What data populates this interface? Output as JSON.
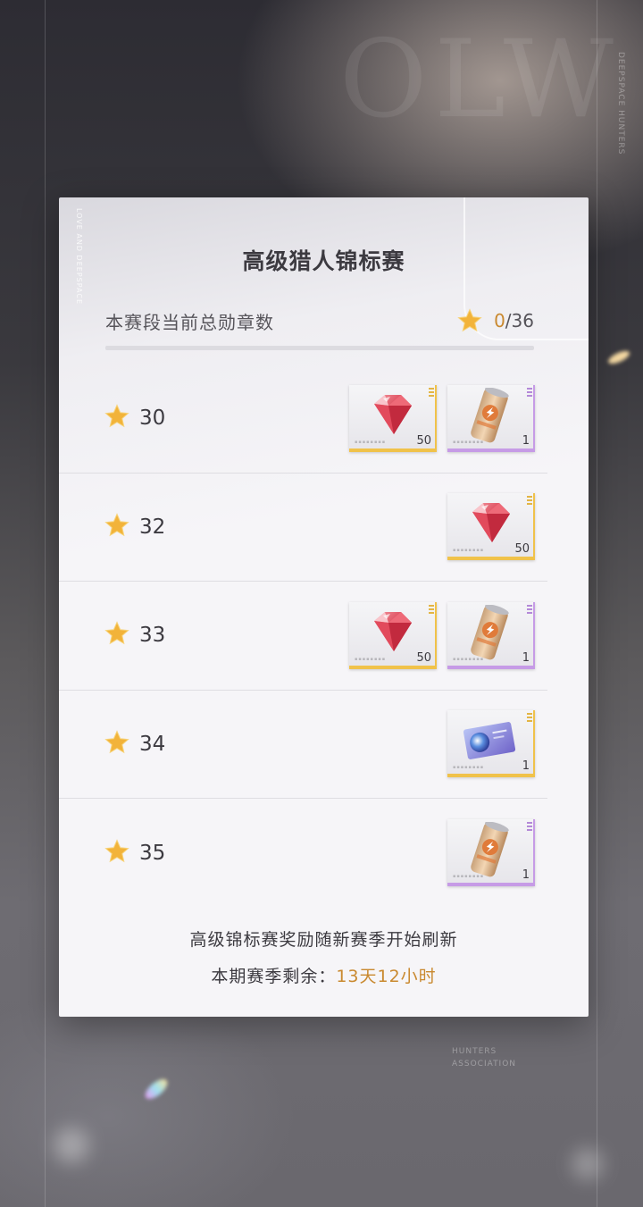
{
  "background": {
    "side_text": "DEEPSPACE HUNTERS",
    "bottom_text_1": "HUNTERS",
    "bottom_text_2": "ASSOCIATION",
    "panel_vertical_text": "LOVE AND DEEPSPACE"
  },
  "panel": {
    "title": "高级猎人锦标赛",
    "summary": {
      "label": "本赛段当前总勋章数",
      "current": "0",
      "separator": "/",
      "total": "36",
      "progress": 0
    },
    "tiers": [
      {
        "value": "30",
        "rewards": [
          {
            "item": "ruby-gem",
            "qty": "50",
            "rarity": "gold"
          },
          {
            "item": "energy-drink-can",
            "qty": "1",
            "rarity": "purple"
          }
        ]
      },
      {
        "value": "32",
        "rewards": [
          {
            "item": "ruby-gem",
            "qty": "50",
            "rarity": "gold"
          }
        ]
      },
      {
        "value": "33",
        "rewards": [
          {
            "item": "ruby-gem",
            "qty": "50",
            "rarity": "gold"
          },
          {
            "item": "energy-drink-can",
            "qty": "1",
            "rarity": "purple"
          }
        ]
      },
      {
        "value": "34",
        "rewards": [
          {
            "item": "planet-ticket",
            "qty": "1",
            "rarity": "gold"
          }
        ]
      },
      {
        "value": "35",
        "rewards": [
          {
            "item": "energy-drink-can",
            "qty": "1",
            "rarity": "purple"
          }
        ]
      }
    ],
    "footer": {
      "line1": "高级锦标赛奖励随新赛季开始刷新",
      "line2_label": "本期赛季剩余：",
      "line2_time": "13天12小时"
    }
  },
  "colors": {
    "accent_orange": "#c9892f",
    "gold_rarity": "#f0c24a",
    "purple_rarity": "#c69be6",
    "star": "#f2b33a"
  }
}
